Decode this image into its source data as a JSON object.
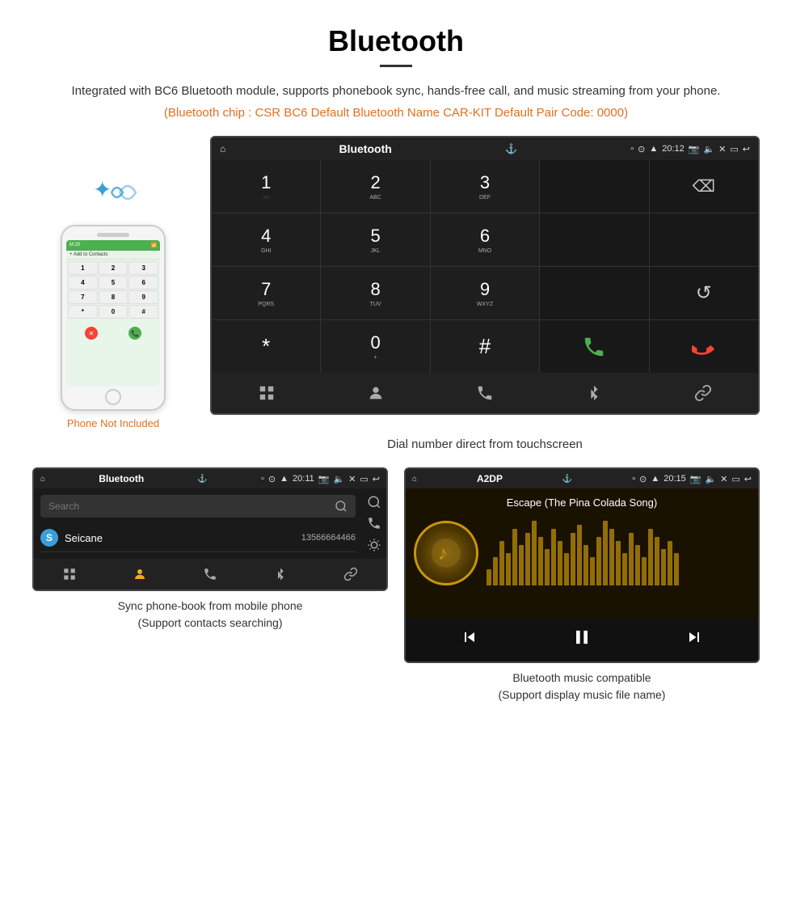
{
  "header": {
    "title": "Bluetooth",
    "description": "Integrated with BC6 Bluetooth module, supports phonebook sync, hands-free call, and music streaming from your phone.",
    "orange_info": "(Bluetooth chip : CSR BC6    Default Bluetooth Name CAR-KIT     Default Pair Code: 0000)"
  },
  "phone_label": "Phone Not Included",
  "dial_screen": {
    "app_title": "Bluetooth",
    "time": "20:12",
    "keypad": [
      {
        "num": "1",
        "sub": "◌◌"
      },
      {
        "num": "2",
        "sub": "ABC"
      },
      {
        "num": "3",
        "sub": "DEF"
      },
      {
        "num": "",
        "sub": ""
      },
      {
        "num": "⌫",
        "sub": ""
      },
      {
        "num": "4",
        "sub": "GHI"
      },
      {
        "num": "5",
        "sub": "JKL"
      },
      {
        "num": "6",
        "sub": "MNO"
      },
      {
        "num": "",
        "sub": ""
      },
      {
        "num": "",
        "sub": ""
      },
      {
        "num": "7",
        "sub": "PQRS"
      },
      {
        "num": "8",
        "sub": "TUV"
      },
      {
        "num": "9",
        "sub": "WXYZ"
      },
      {
        "num": "",
        "sub": ""
      },
      {
        "num": "↺",
        "sub": ""
      },
      {
        "num": "*",
        "sub": ""
      },
      {
        "num": "0",
        "sub": "+"
      },
      {
        "num": "#",
        "sub": ""
      },
      {
        "num": "📞",
        "sub": "green"
      },
      {
        "num": "📞",
        "sub": "red"
      }
    ],
    "bottom_nav": [
      "grid",
      "person",
      "phone",
      "bluetooth",
      "link"
    ]
  },
  "dial_caption": "Dial number direct from touchscreen",
  "phonebook_screen": {
    "app_title": "Bluetooth",
    "time": "20:11",
    "search_placeholder": "Search",
    "contact": {
      "initial": "S",
      "name": "Seicane",
      "phone": "13566664466"
    },
    "bottom_nav": [
      "grid",
      "person",
      "phone",
      "bluetooth",
      "link"
    ]
  },
  "phonebook_caption_line1": "Sync phone-book from mobile phone",
  "phonebook_caption_line2": "(Support contacts searching)",
  "music_screen": {
    "app_title": "A2DP",
    "time": "20:15",
    "song_title": "Escape (The Pina Colada Song)",
    "eq_bars": [
      20,
      35,
      55,
      40,
      70,
      50,
      65,
      80,
      60,
      45,
      70,
      55,
      40,
      65,
      75,
      50,
      35,
      60,
      80,
      70,
      55,
      40,
      65,
      50,
      35,
      70,
      60,
      45,
      55,
      40
    ]
  },
  "music_caption_line1": "Bluetooth music compatible",
  "music_caption_line2": "(Support display music file name)"
}
